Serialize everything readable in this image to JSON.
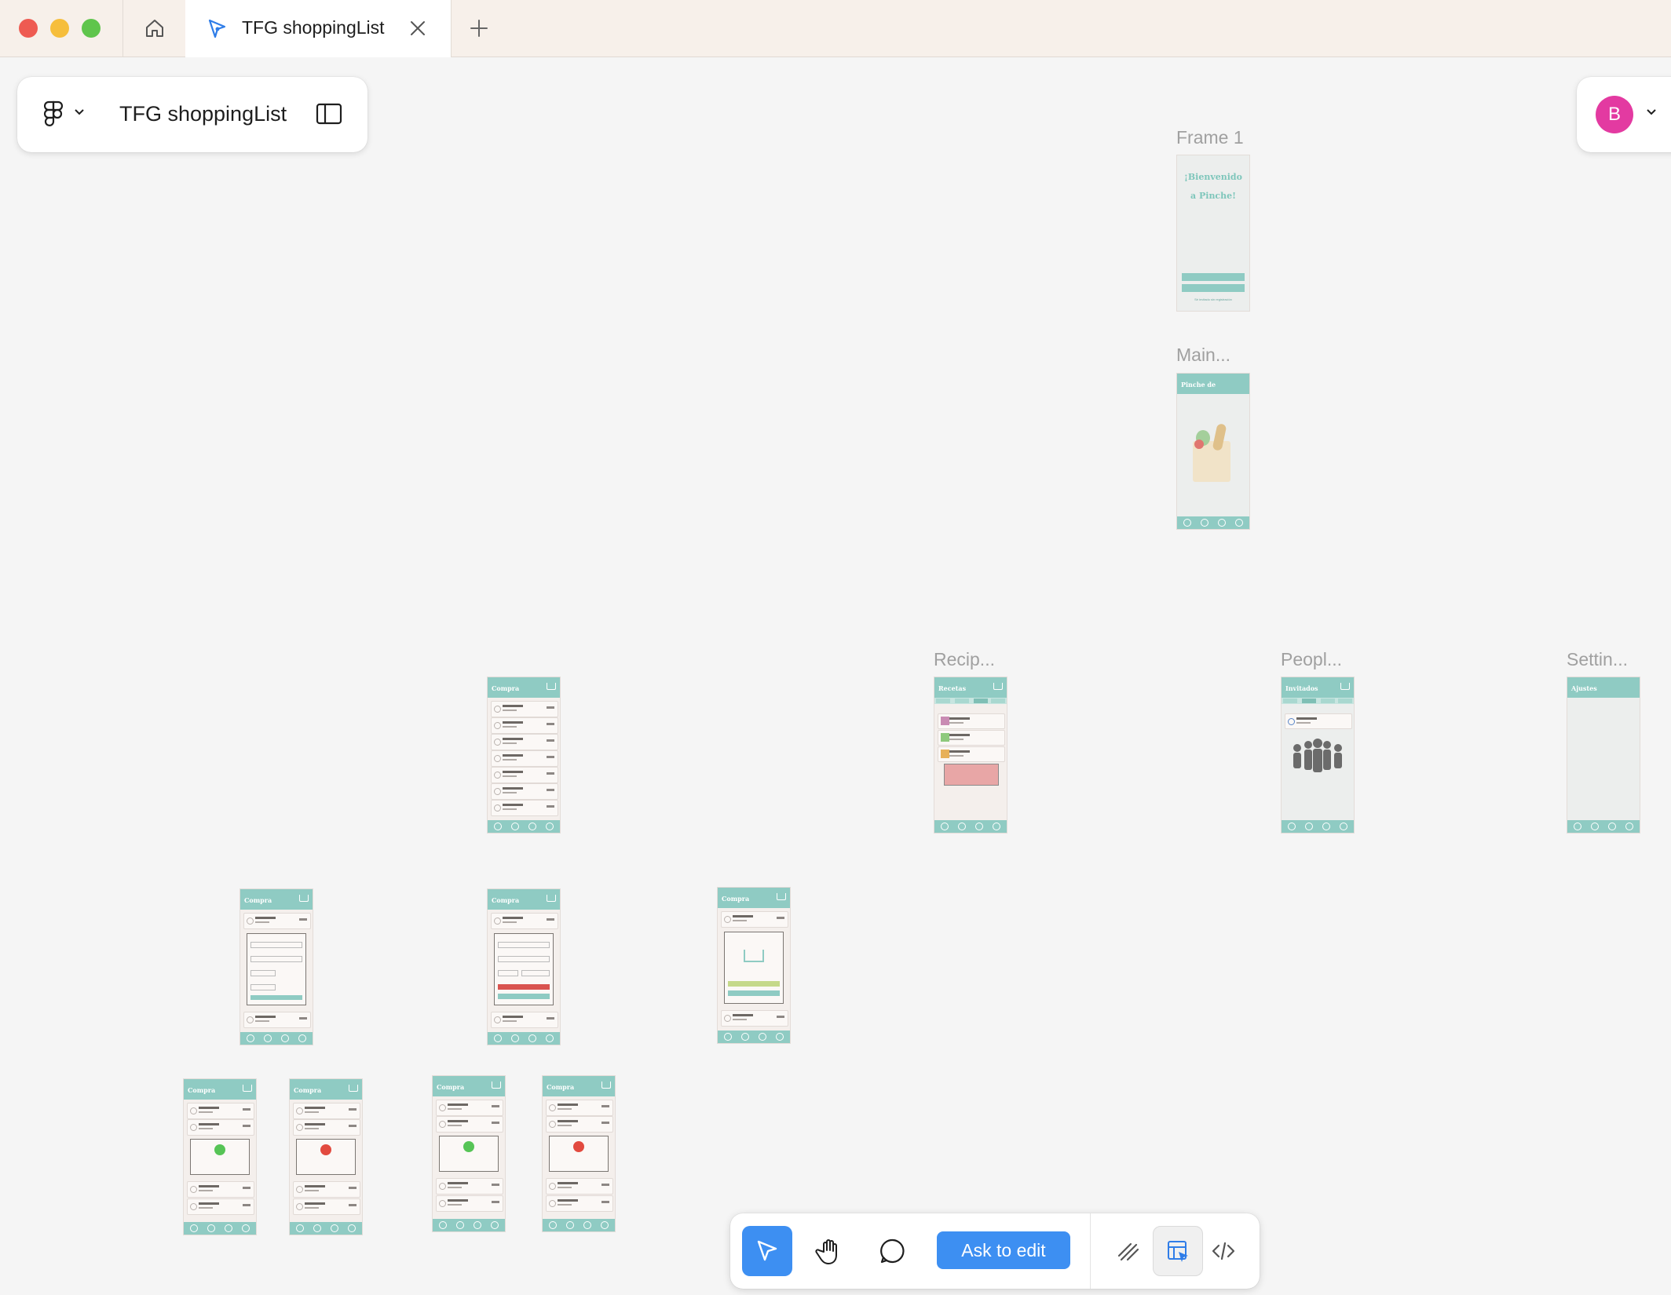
{
  "window": {
    "traffic_lights": {
      "close_color": "#ee5b52",
      "minimize_color": "#f6be3c",
      "zoom_color": "#5fc54c"
    }
  },
  "tabs": {
    "home_icon": "home-icon",
    "active_tab": {
      "label": "TFG shoppingList",
      "icon": "figma-file-icon"
    },
    "new_tab_icon": "plus-icon"
  },
  "file_panel": {
    "file_name": "TFG shoppingList",
    "menu_icon": "figma-logo-icon",
    "sidebar_icon": "sidebar-toggle-icon"
  },
  "user": {
    "avatar_initial": "B",
    "avatar_color": "#e33aa1"
  },
  "canvas": {
    "frame_labels": {
      "frame1": "Frame 1",
      "main": "Main...",
      "recipes": "Recip...",
      "people": "Peopl...",
      "settings": "Settin..."
    },
    "frame_texts": {
      "welcome": "¡Bienvenido a Pinche!",
      "guest": "Sé invitado sin registración",
      "main_header": "Pinche de",
      "shopping_header": "Compra",
      "recipes_header": "Recetas",
      "people_header": "Invitados",
      "settings_header": "Ajustes"
    }
  },
  "toolbar": {
    "ask_to_edit_label": "Ask to edit",
    "accent_color": "#3d8ff2",
    "tools": [
      "move-icon",
      "hand-icon",
      "comment-icon",
      "draw-icon",
      "dev-mode-icon",
      "code-icon"
    ]
  }
}
